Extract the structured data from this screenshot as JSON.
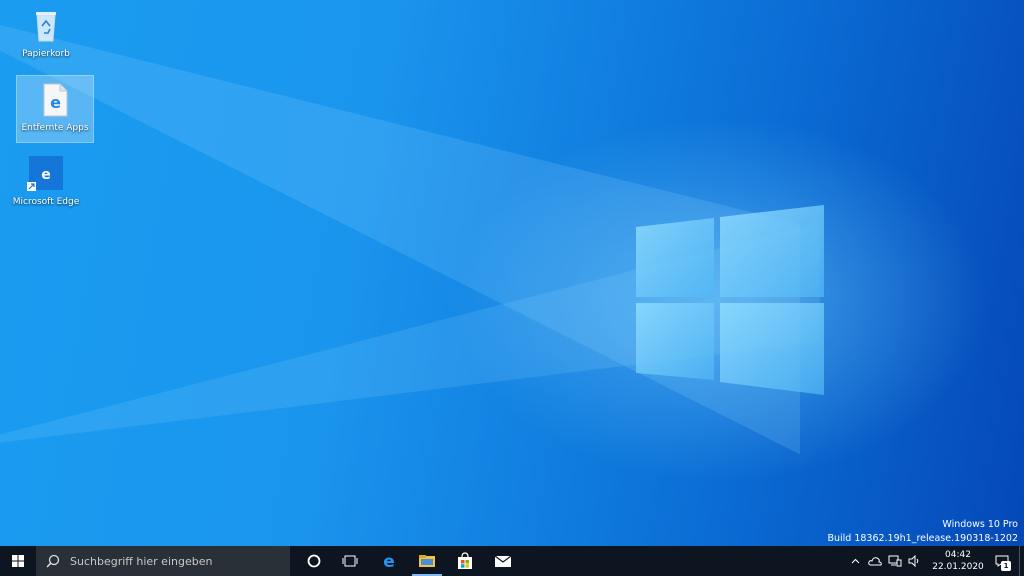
{
  "desktop": {
    "icons": [
      {
        "label": "Papierkorb",
        "icon": "recycle-bin-icon"
      },
      {
        "label": "Entfernte Apps",
        "icon": "html-document-icon"
      },
      {
        "label": "Microsoft Edge",
        "icon": "edge-shortcut-icon"
      }
    ],
    "watermark": {
      "line1": "Windows 10 Pro",
      "line2": "Build 18362.19h1_release.190318-1202"
    }
  },
  "taskbar": {
    "search_placeholder": "Suchbegriff hier eingeben",
    "apps": [
      {
        "name": "Microsoft Edge",
        "icon": "edge-icon"
      },
      {
        "name": "Explorer",
        "icon": "file-explorer-icon"
      },
      {
        "name": "Microsoft Store",
        "icon": "store-icon"
      },
      {
        "name": "Mail",
        "icon": "mail-icon"
      }
    ],
    "clock": {
      "time": "04:42",
      "date": "22.01.2020"
    },
    "notification_count": "1"
  },
  "colors": {
    "taskbar_bg": "#0d1520",
    "desktop_blue": "#0b6fd6",
    "edge_blue": "#1e88e5"
  }
}
